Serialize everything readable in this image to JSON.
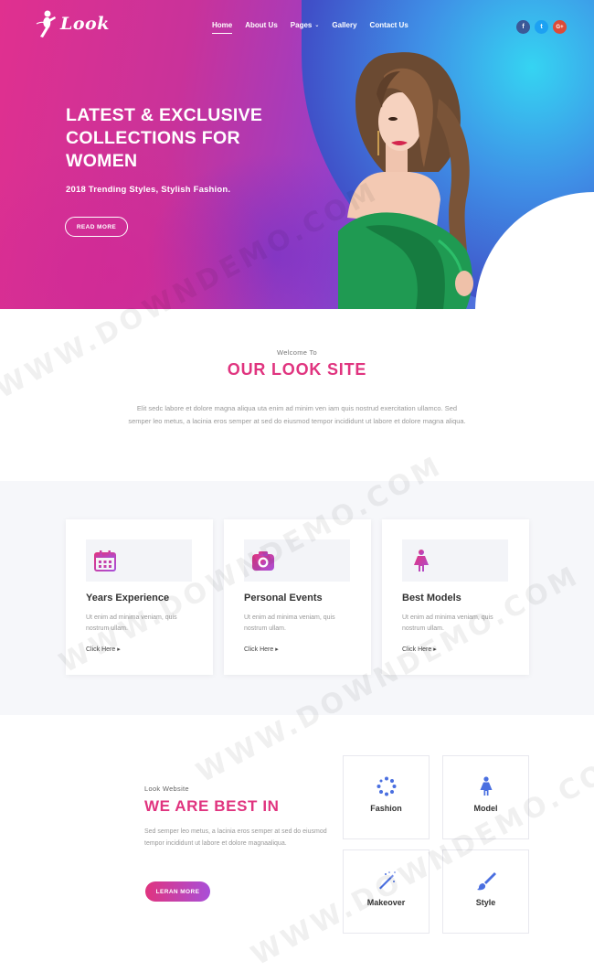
{
  "brand": {
    "logo_text": "Look"
  },
  "nav": {
    "items": [
      {
        "label": "Home",
        "active": true
      },
      {
        "label": "About Us",
        "active": false
      },
      {
        "label": "Pages",
        "active": false,
        "dropdown": true
      },
      {
        "label": "Gallery",
        "active": false
      },
      {
        "label": "Contact Us",
        "active": false
      }
    ]
  },
  "social": [
    {
      "icon": "facebook-icon",
      "glyph": "f",
      "color": "#3b5998"
    },
    {
      "icon": "twitter-icon",
      "glyph": "t",
      "color": "#1da1f2"
    },
    {
      "icon": "google-plus-icon",
      "glyph": "G+",
      "color": "#dd4b39"
    }
  ],
  "hero": {
    "title_line1": "LATEST & EXCLUSIVE",
    "title_line2": "COLLECTIONS FOR",
    "title_line3": "WOMEN",
    "subtitle": "2018 Trending Styles, Stylish Fashion.",
    "button_label": "READ MORE"
  },
  "welcome": {
    "small": "Welcome To",
    "title": "OUR LOOK SITE",
    "text": "Elit sedc labore et dolore magna aliqua uta enim ad minim ven iam quis nostrud exercitation ullamco. Sed semper leo metus, a lacinia eros semper at sed do eiusmod tempor incididunt ut labore et dolore magna aliqua."
  },
  "features": [
    {
      "icon": "calendar-icon",
      "title": "Years Experience",
      "text": "Ut enim ad minima veniam, quis nostrum ullam.",
      "link": "Click Here"
    },
    {
      "icon": "camera-icon",
      "title": "Personal Events",
      "text": "Ut enim ad minima veniam, quis nostrum ullam.",
      "link": "Click Here"
    },
    {
      "icon": "woman-icon",
      "title": "Best Models",
      "text": "Ut enim ad minima veniam, quis nostrum ullam.",
      "link": "Click Here"
    }
  ],
  "best": {
    "small": "Look Website",
    "title": "WE ARE BEST IN",
    "text": "Sed semper leo metus, a lacinia eros semper at sed do eiusmod tempor incididunt ut labore et dolore magnaaliqua.",
    "button_label": "LERAN MORE",
    "services": [
      {
        "icon": "dots-circle-icon",
        "label": "Fashion"
      },
      {
        "icon": "model-icon",
        "label": "Model"
      },
      {
        "icon": "magic-wand-icon",
        "label": "Makeover"
      },
      {
        "icon": "brush-icon",
        "label": "Style"
      }
    ]
  },
  "watermark": {
    "text": "WWW.DOWNDEMO.COM"
  },
  "colors": {
    "accent": "#e0347f",
    "purple": "#a94fd8",
    "icon_blue": "#4a6fe0"
  }
}
